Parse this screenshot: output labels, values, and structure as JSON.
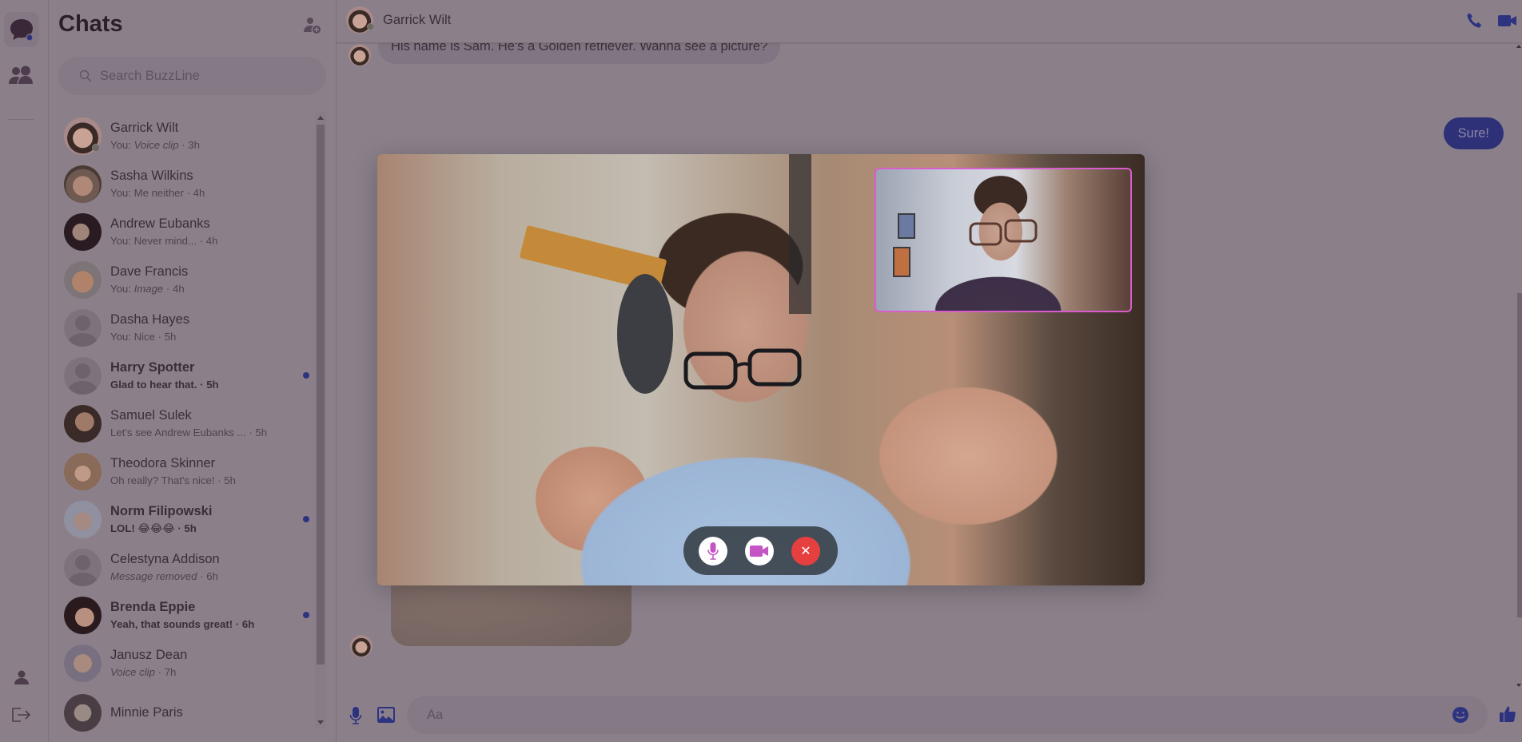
{
  "app": {
    "name": "BuzzLine"
  },
  "colors": {
    "accent": "#2e3380",
    "unread_dot": "#2e3380",
    "pip_border": "#d85dcc",
    "end_call": "#e5403f",
    "control_icon": "#c355c4"
  },
  "rail": {
    "items": [
      {
        "name": "chats",
        "icon": "chat-bubble-icon",
        "active": true,
        "has_badge": true
      },
      {
        "name": "people",
        "icon": "people-icon",
        "active": false
      }
    ],
    "bottom": [
      {
        "name": "profile",
        "icon": "user-icon"
      },
      {
        "name": "logout",
        "icon": "logout-icon"
      }
    ]
  },
  "sidebar": {
    "title": "Chats",
    "add_contact_icon": "add-user-icon",
    "search": {
      "placeholder": "Search BuzzLine",
      "value": ""
    },
    "chats": [
      {
        "name": "Garrick Wilt",
        "prefix": "You: ",
        "preview": "Voice clip",
        "italic": true,
        "time": "3h",
        "unread": false,
        "online": true,
        "avatar": "photo"
      },
      {
        "name": "Sasha Wilkins",
        "prefix": "You: ",
        "preview": "Me neither",
        "italic": false,
        "time": "4h",
        "unread": false,
        "avatar": "photo"
      },
      {
        "name": "Andrew Eubanks",
        "prefix": "You: ",
        "preview": "Never mind...",
        "italic": false,
        "time": "4h",
        "unread": false,
        "avatar": "photo"
      },
      {
        "name": "Dave Francis",
        "prefix": "You: ",
        "preview": "Image",
        "italic": true,
        "time": "4h",
        "unread": false,
        "avatar": "photo"
      },
      {
        "name": "Dasha Hayes",
        "prefix": "You: ",
        "preview": "Nice",
        "italic": false,
        "time": "5h",
        "unread": false,
        "avatar": "default"
      },
      {
        "name": "Harry Spotter",
        "prefix": "",
        "preview": "Glad to hear that.",
        "italic": false,
        "time": "5h",
        "unread": true,
        "avatar": "default"
      },
      {
        "name": "Samuel Sulek",
        "prefix": "",
        "preview": "Let's see Andrew Eubanks ...",
        "italic": false,
        "time": "5h",
        "unread": false,
        "avatar": "photo"
      },
      {
        "name": "Theodora Skinner",
        "prefix": "",
        "preview": "Oh really? That's nice!",
        "italic": false,
        "time": "5h",
        "unread": false,
        "avatar": "photo"
      },
      {
        "name": "Norm Filipowski",
        "prefix": "",
        "preview": "LOL! 😂😂😂",
        "italic": false,
        "time": "5h",
        "unread": true,
        "avatar": "photo"
      },
      {
        "name": "Celestyna Addison",
        "prefix": "",
        "preview": "Message removed",
        "italic": true,
        "time": "6h",
        "unread": false,
        "avatar": "default"
      },
      {
        "name": "Brenda Eppie",
        "prefix": "",
        "preview": "Yeah, that sounds great!",
        "italic": false,
        "time": "6h",
        "unread": true,
        "avatar": "photo"
      },
      {
        "name": "Janusz Dean",
        "prefix": "",
        "preview": "Voice clip",
        "italic": true,
        "time": "7h",
        "unread": false,
        "avatar": "photo"
      },
      {
        "name": "Minnie Paris",
        "prefix": "",
        "preview": "",
        "italic": false,
        "time": "",
        "unread": false,
        "avatar": "photo"
      }
    ]
  },
  "conversation": {
    "contact_name": "Garrick Wilt",
    "contact_online": true,
    "actions": [
      {
        "name": "voice-call",
        "icon": "phone-icon"
      },
      {
        "name": "video-call",
        "icon": "video-camera-icon"
      }
    ],
    "messages": [
      {
        "from": "them",
        "type": "text",
        "text": "His name is Sam. He's a Golden retriever. Wanna see a picture?"
      },
      {
        "from": "me",
        "type": "text",
        "text": "Sure!"
      },
      {
        "from": "them",
        "type": "image",
        "description": "dog paws on carpet"
      }
    ],
    "composer": {
      "placeholder": "Aa",
      "value": ""
    }
  },
  "video_call": {
    "active": true,
    "remote_feed": "remote participant video",
    "self_view": "local camera preview",
    "controls": [
      {
        "name": "mute-microphone",
        "icon": "microphone-icon"
      },
      {
        "name": "toggle-camera",
        "icon": "video-camera-icon"
      },
      {
        "name": "end-call",
        "icon": "close-icon",
        "glyph": "✕"
      }
    ]
  }
}
